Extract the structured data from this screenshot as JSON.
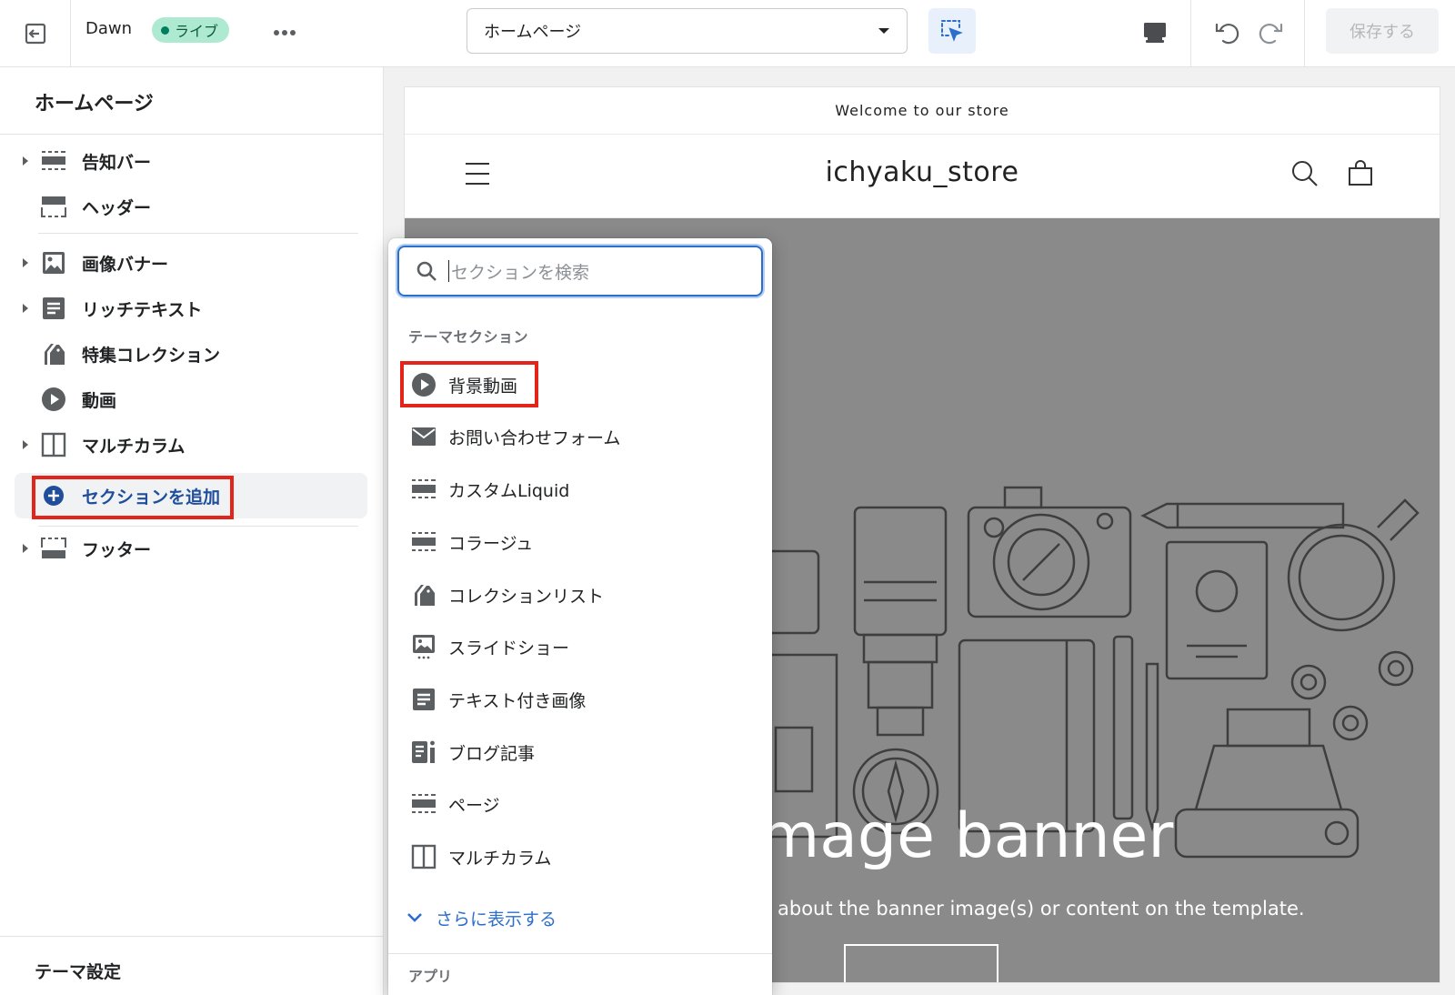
{
  "topbar": {
    "theme_name": "Dawn",
    "status_badge": "ライブ",
    "page_select": {
      "value": "ホームページ"
    },
    "save_button": "保存する",
    "icons": [
      "exit-icon",
      "more-icon",
      "chevron-down-icon",
      "inspector-icon",
      "desktop-icon",
      "undo-icon",
      "redo-icon"
    ]
  },
  "sidebar": {
    "title": "ホームページ",
    "items": [
      {
        "label": "告知バー",
        "icon": "announcement-bar-icon",
        "expandable": true
      },
      {
        "label": "ヘッダー",
        "icon": "header-icon",
        "expandable": false
      },
      {
        "label": "画像バナー",
        "icon": "image-icon",
        "expandable": true
      },
      {
        "label": "リッチテキスト",
        "icon": "text-icon",
        "expandable": true
      },
      {
        "label": "特集コレクション",
        "icon": "collection-icon",
        "expandable": false
      },
      {
        "label": "動画",
        "icon": "play-icon",
        "expandable": false
      },
      {
        "label": "マルチカラム",
        "icon": "columns-icon",
        "expandable": true
      }
    ],
    "add_section": "セクションを追加",
    "footer": {
      "label": "フッター",
      "icon": "footer-icon",
      "expandable": true
    },
    "theme_settings": "テーマ設定"
  },
  "preview": {
    "announcement": "Welcome to our store",
    "store_name": "ichyaku_store",
    "banner_title": "mage banner",
    "banner_subtitle": "about the banner image(s) or content on the template."
  },
  "popover": {
    "search_placeholder": "セクションを検索",
    "theme_sections_heading": "テーマセクション",
    "items": [
      {
        "label": "背景動画",
        "icon": "play-icon"
      },
      {
        "label": "お問い合わせフォーム",
        "icon": "envelope-icon"
      },
      {
        "label": "カスタムLiquid",
        "icon": "section-icon"
      },
      {
        "label": "コラージュ",
        "icon": "section-icon"
      },
      {
        "label": "コレクションリスト",
        "icon": "collection-icon"
      },
      {
        "label": "スライドショー",
        "icon": "slideshow-icon"
      },
      {
        "label": "テキスト付き画像",
        "icon": "text-icon"
      },
      {
        "label": "ブログ記事",
        "icon": "blog-icon"
      },
      {
        "label": "ページ",
        "icon": "section-icon"
      },
      {
        "label": "マルチカラム",
        "icon": "columns-icon"
      }
    ],
    "show_more": "さらに表示する",
    "apps_heading": "アプリ"
  },
  "colors": {
    "highlight": "#e3241b",
    "link_blue": "#2c6ecb",
    "add_section_blue": "#1f4e9b",
    "live_badge_bg": "#aee9d1",
    "banner_bg": "#8a8a8a"
  }
}
